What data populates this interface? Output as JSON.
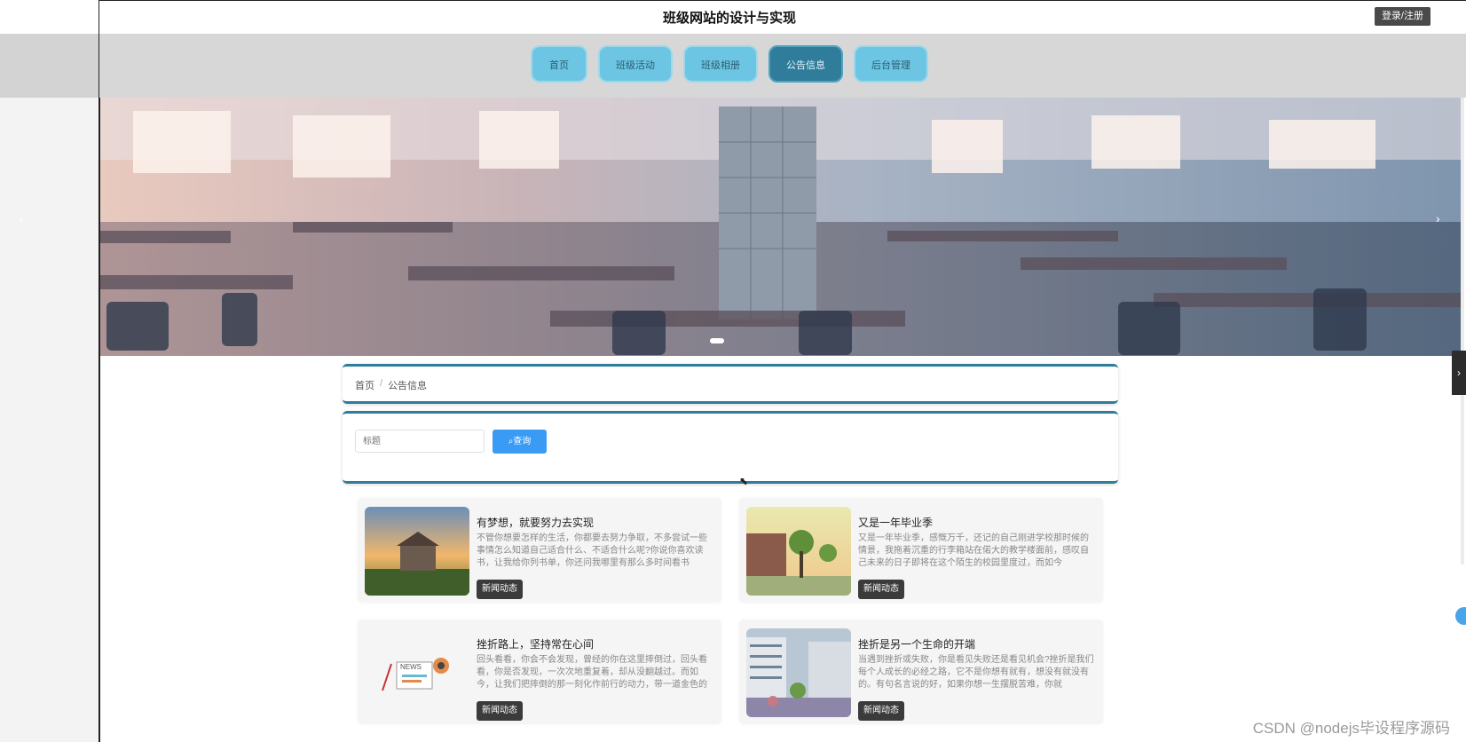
{
  "header": {
    "title": "班级网站的设计与实现",
    "login": "登录/注册"
  },
  "nav": [
    {
      "label": "首页",
      "active": false
    },
    {
      "label": "班级活动",
      "active": false
    },
    {
      "label": "班级相册",
      "active": false
    },
    {
      "label": "公告信息",
      "active": true
    },
    {
      "label": "后台管理",
      "active": false
    }
  ],
  "breadcrumb": {
    "home": "首页",
    "separator": "/",
    "current": "公告信息"
  },
  "search": {
    "placeholder": "标题",
    "button": "查询"
  },
  "cards": [
    {
      "title": "有梦想，就要努力去实现",
      "desc": "不管你想要怎样的生活，你都要去努力争取，不多尝试一些事情怎么知道自己适合什么、不适合什么呢?你说你喜欢读书，让我给你列书单，你还问我哪里有那么多时间看书",
      "tag": "新闻动态"
    },
    {
      "title": "又是一年毕业季",
      "desc": "又是一年毕业季，感慨万千，还记的自己刚进学校那时候的情景，我拖着沉重的行李箱站在偌大的教学楼面前，感叹自己未来的日子即将在这个陌生的校园里度过，而如今",
      "tag": "新闻动态"
    },
    {
      "title": "挫折路上，坚持常在心间",
      "desc": "回头看看，你会不会发现，曾经的你在这里摔倒过，回头看看，你是否发现，一次次地重复着，却从没翻越过。而如今，让我们把摔倒的那一刻化作前行的动力，带一道金色的弧线，悬挂",
      "tag": "新闻动态"
    },
    {
      "title": "挫折是另一个生命的开端",
      "desc": "当遇到挫折或失败，你是看见失败还是看见机会?挫折是我们每个人成长的必经之路，它不是你想有就有，想没有就没有的。有句名言说的好，如果你想一生摆脱苦难，你就",
      "tag": "新闻动态"
    }
  ],
  "watermark": "CSDN @nodejs毕设程序源码",
  "colors": {
    "nav": "#6cc6e3",
    "nav_active": "#2f7d9b",
    "accent": "#3a9bf4"
  }
}
